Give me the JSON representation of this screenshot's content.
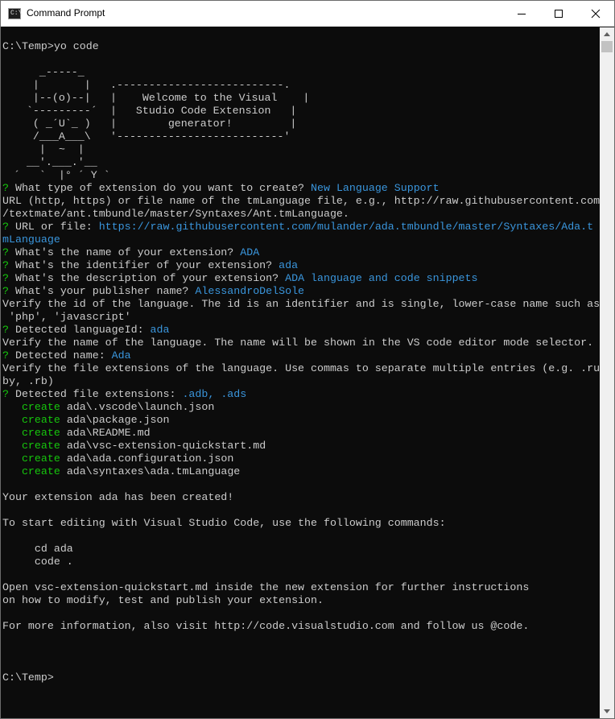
{
  "window": {
    "title": "Command Prompt",
    "icon": "cmd-icon"
  },
  "controls": {
    "minimize": "minimize-icon",
    "maximize": "maximize-icon",
    "close": "close-icon"
  },
  "colors": {
    "background": "#0c0c0c",
    "text": "#cccccc",
    "prompt_mark": "#16c60c",
    "answer": "#3a96dd",
    "create": "#16c60c"
  },
  "console": {
    "command_line": "C:\\Temp>yo code",
    "banner": {
      "art": "     _-----_\n    |       |\n    |--(o)--|\n   `---------´\n    ( _´U`_ )\n    /___A___\\\n     |  ~  |\n   __'.___.'__\n ´   `  |° ´ Y `",
      "box": ".--------------------------.\n|    Welcome to the Visual    |\n|   Studio Code Extension   |\n|        generator!         |\n'--------------------------'"
    },
    "q_type": {
      "mark": "?",
      "label": " What type of extension do you want to create? ",
      "answer": "New Language Support"
    },
    "url_info_1": "URL (http, https) or file name of the tmLanguage file, e.g., http://raw.githubusercontent.com",
    "url_info_2": "/textmate/ant.tmbundle/master/Syntaxes/Ant.tmLanguage.",
    "q_url": {
      "mark": "?",
      "label": " URL or file: ",
      "answer": "https://raw.githubusercontent.com/mulander/ada.tmbundle/master/Syntaxes/Ada.t",
      "answer_wrap": "mLanguage"
    },
    "q_name": {
      "mark": "?",
      "label": " What's the name of your extension? ",
      "answer": "ADA"
    },
    "q_identifier": {
      "mark": "?",
      "label": " What's the identifier of your extension? ",
      "answer": "ada"
    },
    "q_description": {
      "mark": "?",
      "label": " What's the description of your extension? ",
      "answer": "ADA language and code snippets"
    },
    "q_publisher": {
      "mark": "?",
      "label": " What's your publisher name? ",
      "answer": "AlessandroDelSole"
    },
    "id_info_1": "Verify the id of the language. The id is an identifier and is single, lower-case name such as",
    "id_info_2": " 'php', 'javascript'",
    "q_lang_id": {
      "mark": "?",
      "label": " Detected languageId: ",
      "answer": "ada"
    },
    "name_info": "Verify the name of the language. The name will be shown in the VS code editor mode selector.",
    "q_lang_name": {
      "mark": "?",
      "label": " Detected name: ",
      "answer": "Ada"
    },
    "ext_info_1": "Verify the file extensions of the language. Use commas to separate multiple entries (e.g. .ru",
    "ext_info_2": "by, .rb)",
    "q_extensions": {
      "mark": "?",
      "label": " Detected file extensions: ",
      "answer": ".adb, .ads"
    },
    "created_files": [
      {
        "verb": "create",
        "path": "ada\\.vscode\\launch.json"
      },
      {
        "verb": "create",
        "path": "ada\\package.json"
      },
      {
        "verb": "create",
        "path": "ada\\README.md"
      },
      {
        "verb": "create",
        "path": "ada\\vsc-extension-quickstart.md"
      },
      {
        "verb": "create",
        "path": "ada\\ada.configuration.json"
      },
      {
        "verb": "create",
        "path": "ada\\syntaxes\\ada.tmLanguage"
      }
    ],
    "created_msg": "Your extension ada has been created!",
    "start_msg": "To start editing with Visual Studio Code, use the following commands:",
    "cmd_1": "cd ada",
    "cmd_2": "code .",
    "open_msg_1": "Open vsc-extension-quickstart.md inside the new extension for further instructions",
    "open_msg_2": "on how to modify, test and publish your extension.",
    "more_info": "For more information, also visit http://code.visualstudio.com and follow us @code.",
    "final_prompt": "C:\\Temp>"
  }
}
